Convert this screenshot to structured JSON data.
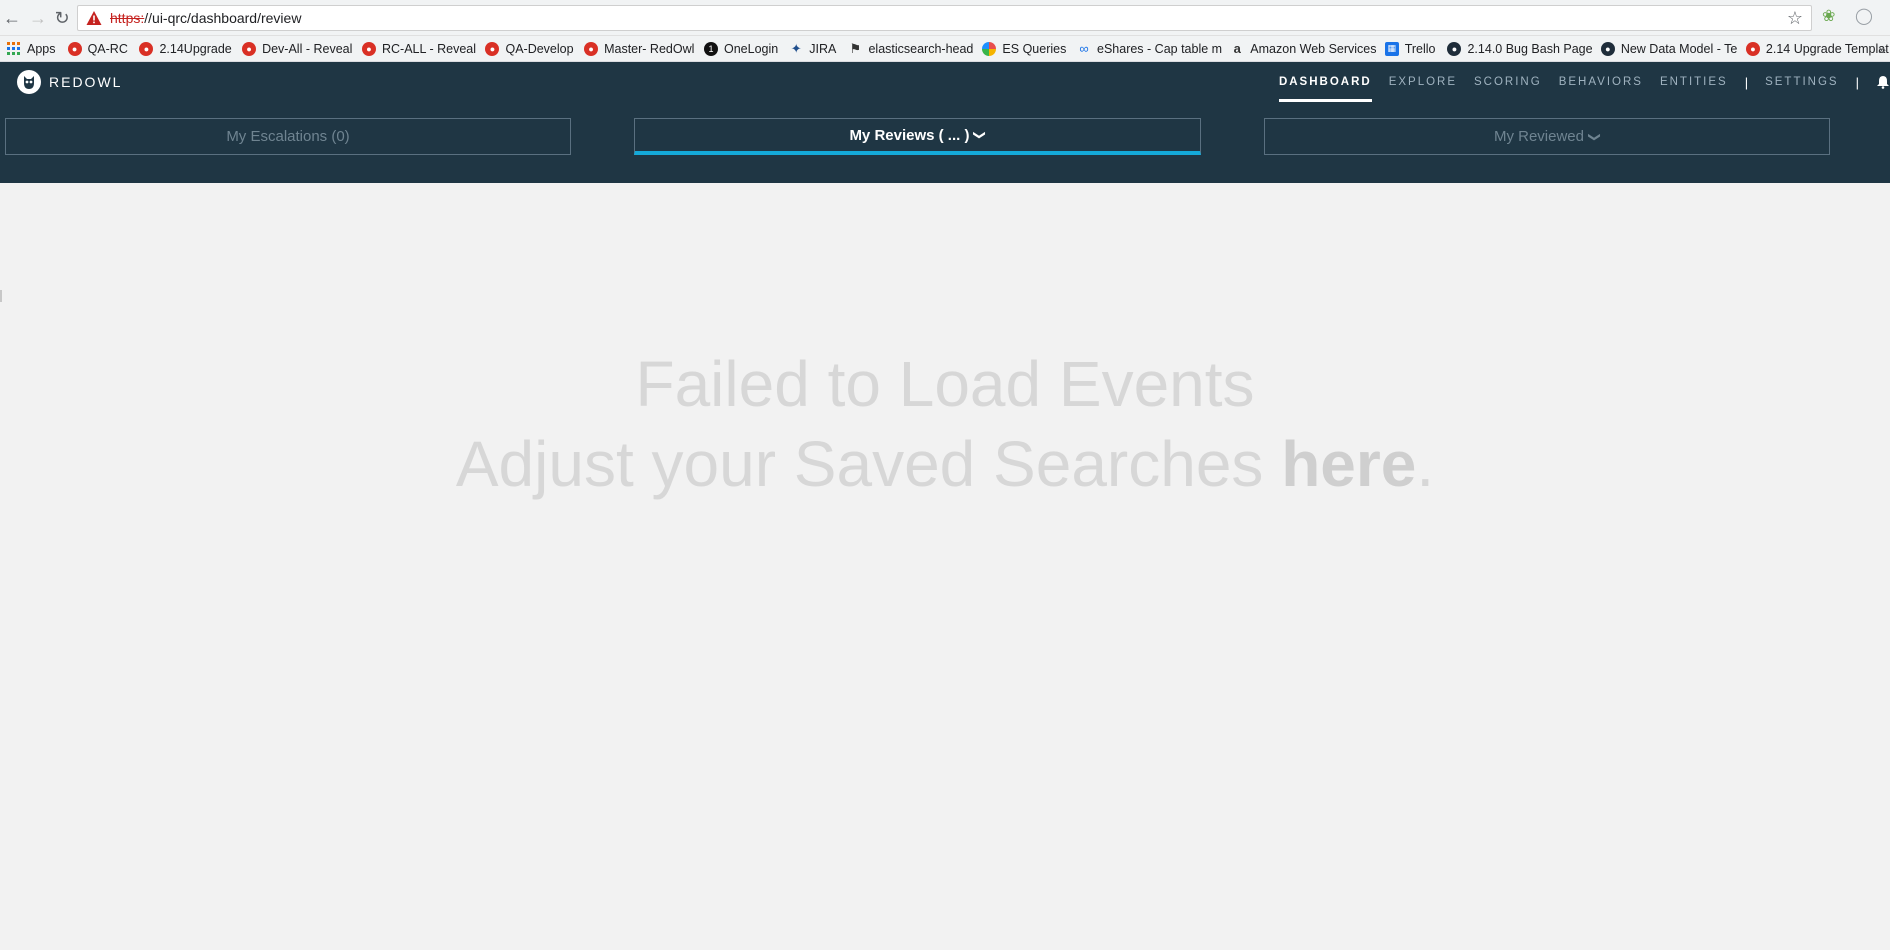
{
  "browser": {
    "url_protocol": "https:",
    "url_rest": "//ui-qrc/dashboard/review",
    "bookmarks": [
      {
        "label": "Apps",
        "icon": "apps-grid-icon"
      },
      {
        "label": "QA-RC",
        "icon": "redowl-icon"
      },
      {
        "label": "2.14Upgrade",
        "icon": "redowl-icon"
      },
      {
        "label": "Dev-All - Reveal",
        "icon": "redowl-icon"
      },
      {
        "label": "RC-ALL - Reveal",
        "icon": "redowl-icon"
      },
      {
        "label": "QA-Develop",
        "icon": "redowl-icon"
      },
      {
        "label": "Master- RedOwl",
        "icon": "redowl-icon"
      },
      {
        "label": "OneLogin",
        "icon": "onelogin-icon"
      },
      {
        "label": "JIRA",
        "icon": "jira-icon"
      },
      {
        "label": "elasticsearch-head",
        "icon": "elasticsearch-icon"
      },
      {
        "label": "ES Queries",
        "icon": "es-queries-icon"
      },
      {
        "label": "eShares - Cap table m",
        "icon": "eshares-icon"
      },
      {
        "label": "Amazon Web Services",
        "icon": "amazon-icon"
      },
      {
        "label": "Trello",
        "icon": "trello-icon"
      },
      {
        "label": "2.14.0 Bug Bash Page",
        "icon": "owl-icon"
      },
      {
        "label": "New Data Model - Te",
        "icon": "owl-icon"
      },
      {
        "label": "2.14 Upgrade Templat",
        "icon": "redowl-icon"
      }
    ],
    "more_bookmarks": "»"
  },
  "app": {
    "logo_text": "REDOWL",
    "nav": [
      {
        "label": "DASHBOARD",
        "active": true
      },
      {
        "label": "EXPLORE",
        "active": false
      },
      {
        "label": "SCORING",
        "active": false
      },
      {
        "label": "BEHAVIORS",
        "active": false
      },
      {
        "label": "ENTITIES",
        "active": false
      }
    ],
    "settings_label": "SETTINGS",
    "separator": "|",
    "tabs": {
      "escalations": "My Escalations (0)",
      "reviews": "My Reviews ( ... )",
      "reviewed": "My Reviewed"
    }
  },
  "main": {
    "message_line1": "Failed to Load Events",
    "message_line2_prefix": "Adjust your Saved Searches ",
    "message_link": "here",
    "message_line2_suffix": "."
  },
  "colors": {
    "header_bg": "#1f3644",
    "active_tab_underline": "#14a9d9",
    "page_bg": "#f2f2f2"
  }
}
